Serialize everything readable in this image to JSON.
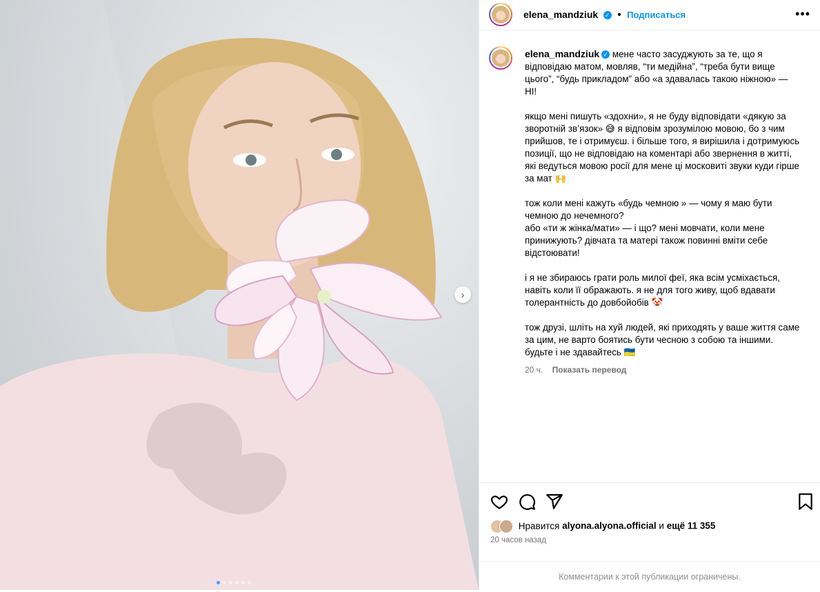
{
  "post": {
    "username": "elena_mandziuk",
    "follow_label": "Подписаться",
    "more_label": "•••",
    "caption": [
      "мене часто засуджують за те, що я відповідаю матом, мовляв, “ти медійна”, “треба бути вище цього”, “будь прикладом” або «а здавалась такою ніжною» — НІ!",
      "якщо мені пишуть «здохни», я не буду відповідати «дякую за зворотній зв’язок» 😅 я відповім зрозумілою мовою, бо з чим прийшов, те і отримуєш. і більше того, я вирішила і дотримуюсь позиції, що не відповідаю на коментарі або звернення в житті, які ведуться мовою росії для мене ці московиті звуки куди гірше за мат 🙌",
      "тож коли мені кажуть «будь чемною » — чому я маю бути чемною до нечемного?\nабо «ти ж жінка/мати» — і що? мені мовчати, коли мене принижують? дівчата та матері також повинні вміти себе відстоювати!",
      "і я не збираюсь грати роль милої феї, яка всім усміхається, навіть коли її ображають. я не для того живу, щоб вдавати толерантність до довбойобів 🤡",
      "тож друзі, шліть на хуй людей, які приходять у ваше життя саме за цим, не варто боятись бути чесною з собою та іншими. будьте і не здавайтесь 🇺🇦"
    ],
    "caption_age": "20 ч.",
    "translate_label": "Показать перевод",
    "likes_prefix": "Нравится",
    "likes_user": "alyona.alyona.official",
    "likes_and": "и",
    "likes_rest": "ещё 11 355",
    "posted_ago": "20 часов назад",
    "comments_closed": "Комментарии к этой публикации ограничены."
  },
  "media": {
    "slides": 6,
    "current_slide": 1,
    "next_icon": "chevron-right-icon"
  },
  "icons": [
    "heart-icon",
    "comment-icon",
    "share-icon",
    "bookmark-icon",
    "verified-icon",
    "more-icon"
  ],
  "colors": {
    "link": "#0095f6",
    "muted": "#737373",
    "border": "#efefef"
  }
}
